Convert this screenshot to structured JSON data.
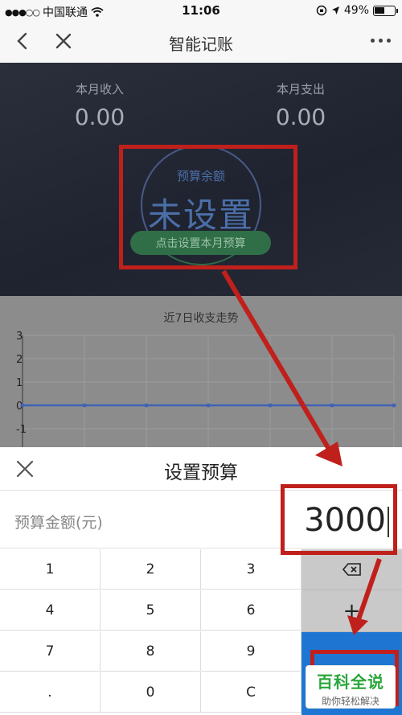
{
  "status_bar": {
    "carrier": "中国联通",
    "time": "11:06",
    "battery": "49%"
  },
  "nav": {
    "title": "智能记账"
  },
  "summary": {
    "income_label": "本月收入",
    "income_value": "0.00",
    "expense_label": "本月支出",
    "expense_value": "0.00"
  },
  "budget": {
    "label": "预算余额",
    "value": "未设置",
    "button": "点击设置本月预算"
  },
  "chart_data": {
    "type": "line",
    "title": "近7日收支走势",
    "yticks": [
      "3",
      "2",
      "1",
      "0",
      "-1"
    ],
    "ylim": [
      -1,
      3
    ],
    "series": [
      {
        "values": [
          0,
          0,
          0,
          0,
          0,
          0,
          0
        ]
      }
    ],
    "grid": true
  },
  "sheet": {
    "title": "设置预算",
    "amount_label": "预算金额(元)",
    "amount_value": "3000"
  },
  "keypad": {
    "keys": [
      "1",
      "2",
      "3",
      "4",
      "5",
      "6",
      "7",
      "8",
      "9",
      ".",
      "0",
      "C"
    ],
    "plus": "+"
  },
  "watermark": {
    "main": "百科全说",
    "sub": "助你轻松解决"
  },
  "colors": {
    "annotation_red": "#c0201c",
    "confirm_blue": "#1f76d2",
    "budget_blue": "#4b6fa8",
    "button_green": "#2f6e46"
  }
}
